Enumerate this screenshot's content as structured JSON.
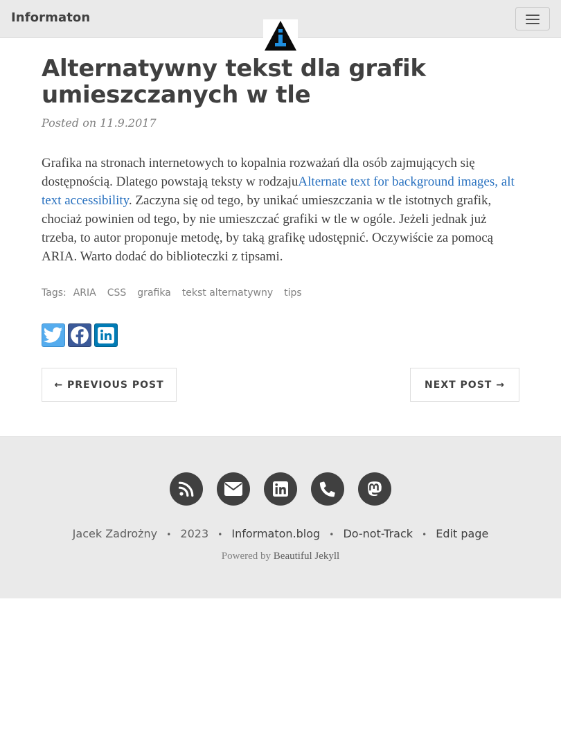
{
  "navbar": {
    "brand": "Informaton",
    "menu_icon": "hamburger-icon",
    "logo_icon": "info-logo-icon"
  },
  "post": {
    "title": "Alternatywny tekst dla grafik umieszczanych w tle",
    "meta": "Posted on 11.9.2017",
    "body_before_link": "Grafika na stronach internetowych to kopalnia rozważań dla osób zajmujących się dostępnością. Dlatego powstają teksty w rodzaju",
    "link_text": "Alternate text for background images, alt text accessibility",
    "body_after_link": ". Zaczyna się od tego, by unikać umieszczania w tle istotnych grafik, chociaż powinien od tego, by nie umieszczać grafiki w tle w ogóle. Jeżeli jednak już trzeba, to autor proponuje metodę, by taką grafikę udostępnić. Oczywiście za pomocą ARIA. Warto dodać do biblioteczki z tipsami.",
    "tags_label": "Tags:",
    "tags": [
      "ARIA",
      "CSS",
      "grafika",
      "tekst alternatywny",
      "tips"
    ]
  },
  "share": {
    "items": [
      {
        "name": "twitter",
        "icon": "twitter-icon",
        "color": "#55acee"
      },
      {
        "name": "facebook",
        "icon": "facebook-icon",
        "color": "#3b5998"
      },
      {
        "name": "linkedin",
        "icon": "linkedin-icon",
        "color": "#007bb5"
      }
    ]
  },
  "pager": {
    "previous": "← Previous Post",
    "next": "Next Post →"
  },
  "footer": {
    "social_icons": [
      "rss-icon",
      "envelope-icon",
      "linkedin-icon",
      "phone-icon",
      "mastodon-icon"
    ],
    "author": "Jacek Zadrożny",
    "year": "2023",
    "site": "Informaton.blog",
    "dnt": "Do-not-Track",
    "edit": "Edit page",
    "separator": "•",
    "powered_prefix": "Powered by",
    "powered_link": "Beautiful Jekyll"
  },
  "colors": {
    "navbar_bg": "#eaeaea",
    "link": "#2a72c0",
    "text": "#404040",
    "footer_bg": "#eaeaea"
  }
}
